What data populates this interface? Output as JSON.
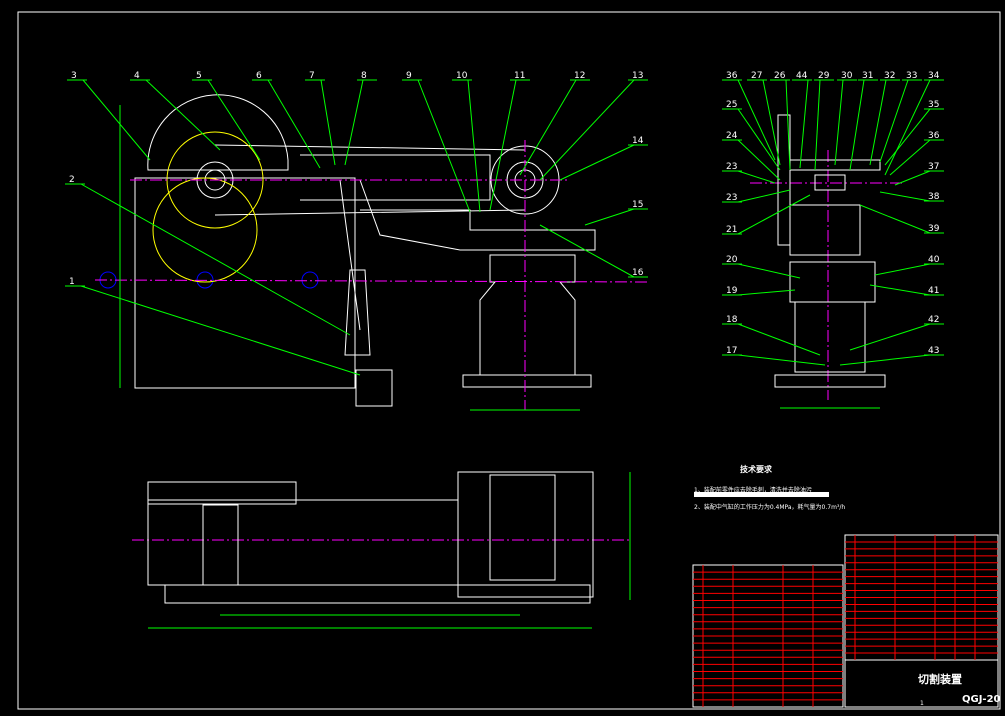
{
  "drawing": {
    "title": "切割装置",
    "code": "QGJ-20",
    "sheet": "1",
    "technical_requirements": {
      "title": "技术要求",
      "items": [
        "1、装配前零件应去除毛刺，清洗并去除油污",
        "2、装配中气缸的工作压力为0.4MPa，耗气量为0.7m³/h"
      ]
    },
    "front_view_labels": [
      "3",
      "4",
      "5",
      "6",
      "7",
      "8",
      "9",
      "10",
      "11",
      "12",
      "13",
      "14",
      "2",
      "15",
      "16",
      "1"
    ],
    "side_view_labels": [
      "36",
      "27",
      "26",
      "44",
      "29",
      "30",
      "31",
      "32",
      "33",
      "34",
      "25",
      "35",
      "24",
      "36",
      "23",
      "37",
      "23",
      "38",
      "21",
      "39",
      "20",
      "40",
      "19",
      "41",
      "18",
      "42",
      "17",
      "43"
    ],
    "colors": {
      "background": "#000000",
      "outline": "#ffffff",
      "centerline": "#ff00ff",
      "leader": "#00ff00",
      "hidden": "#ffff00",
      "dimension": "#00ff00",
      "table": "#ff0000"
    }
  }
}
